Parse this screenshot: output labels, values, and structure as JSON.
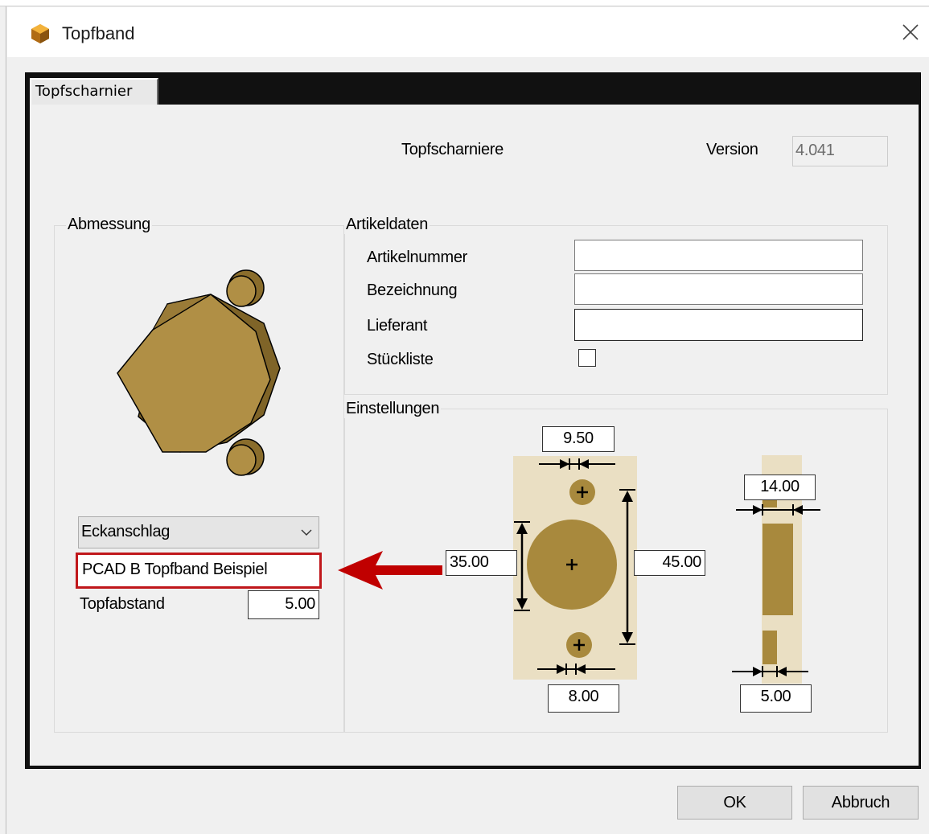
{
  "window": {
    "title": "Topfband",
    "icon": "cube-icon",
    "close_icon": "close-icon"
  },
  "tabs": [
    {
      "label": "Topfscharnier",
      "active": true
    }
  ],
  "header": {
    "heading": "Topfscharniere",
    "version_label": "Version",
    "version_value": "4.041"
  },
  "abmessung": {
    "title": "Abmessung",
    "preview_icon": "hinge-3d-preview",
    "combo_value": "Eckanschlag",
    "name_value": "PCAD B Topfband Beispiel",
    "topfabstand_label": "Topfabstand",
    "topfabstand_value": "5.00"
  },
  "artikeldaten": {
    "title": "Artikeldaten",
    "fields": [
      {
        "label": "Artikelnummer",
        "value": ""
      },
      {
        "label": "Bezeichnung",
        "value": ""
      },
      {
        "label": "Lieferant",
        "value": ""
      }
    ],
    "stueckliste_label": "Stückliste",
    "stueckliste_checked": false
  },
  "einstellungen": {
    "title": "Einstellungen",
    "dim_top": "9.50",
    "dim_left": "35.00",
    "dim_right": "45.00",
    "dim_bottom": "8.00",
    "side_top": "14.00",
    "side_bottom": "5.00"
  },
  "annotation": {
    "arrow_color": "#c00000",
    "highlight_color": "#c00000"
  },
  "colors": {
    "hinge_bg": "#eadfc3",
    "hinge_fill": "#a8893d",
    "frame": "#111111"
  },
  "buttons": {
    "ok": "OK",
    "cancel": "Abbruch"
  }
}
